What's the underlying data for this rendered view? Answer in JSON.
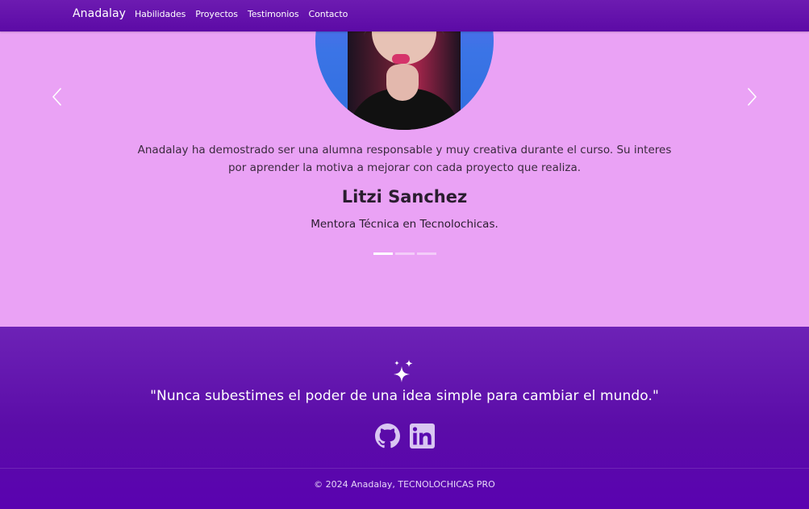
{
  "navbar": {
    "brand": "Anadalay",
    "links": [
      "Habilidades",
      "Proyectos",
      "Testimonios",
      "Contacto"
    ]
  },
  "testimonial": {
    "quote": "Anadalay ha demostrado ser una alumna responsable y muy creativa durante el curso. Su interes por aprender la motiva a mejorar con cada proyecto que realiza.",
    "author": "Litzi Sanchez",
    "role": "Mentora Técnica en Tecnolochicas.",
    "prev_icon": "chevron-left-icon",
    "next_icon": "chevron-right-icon",
    "indicators_count": 3,
    "active_indicator": 0
  },
  "footer": {
    "motto": "\"Nunca subestimes el poder de una idea simple para cambiar el mundo.\"",
    "icons": [
      "sparkles-icon",
      "github-icon",
      "linkedin-icon"
    ],
    "copyright": "© 2024 Anadalay, TECNOLOCHICAS PRO"
  },
  "colors": {
    "navbar": "#5c0aa6",
    "section_bg": "#eaa2f5",
    "footer_bg": "#5a02b0",
    "social_icon": "#d9c6f2"
  }
}
